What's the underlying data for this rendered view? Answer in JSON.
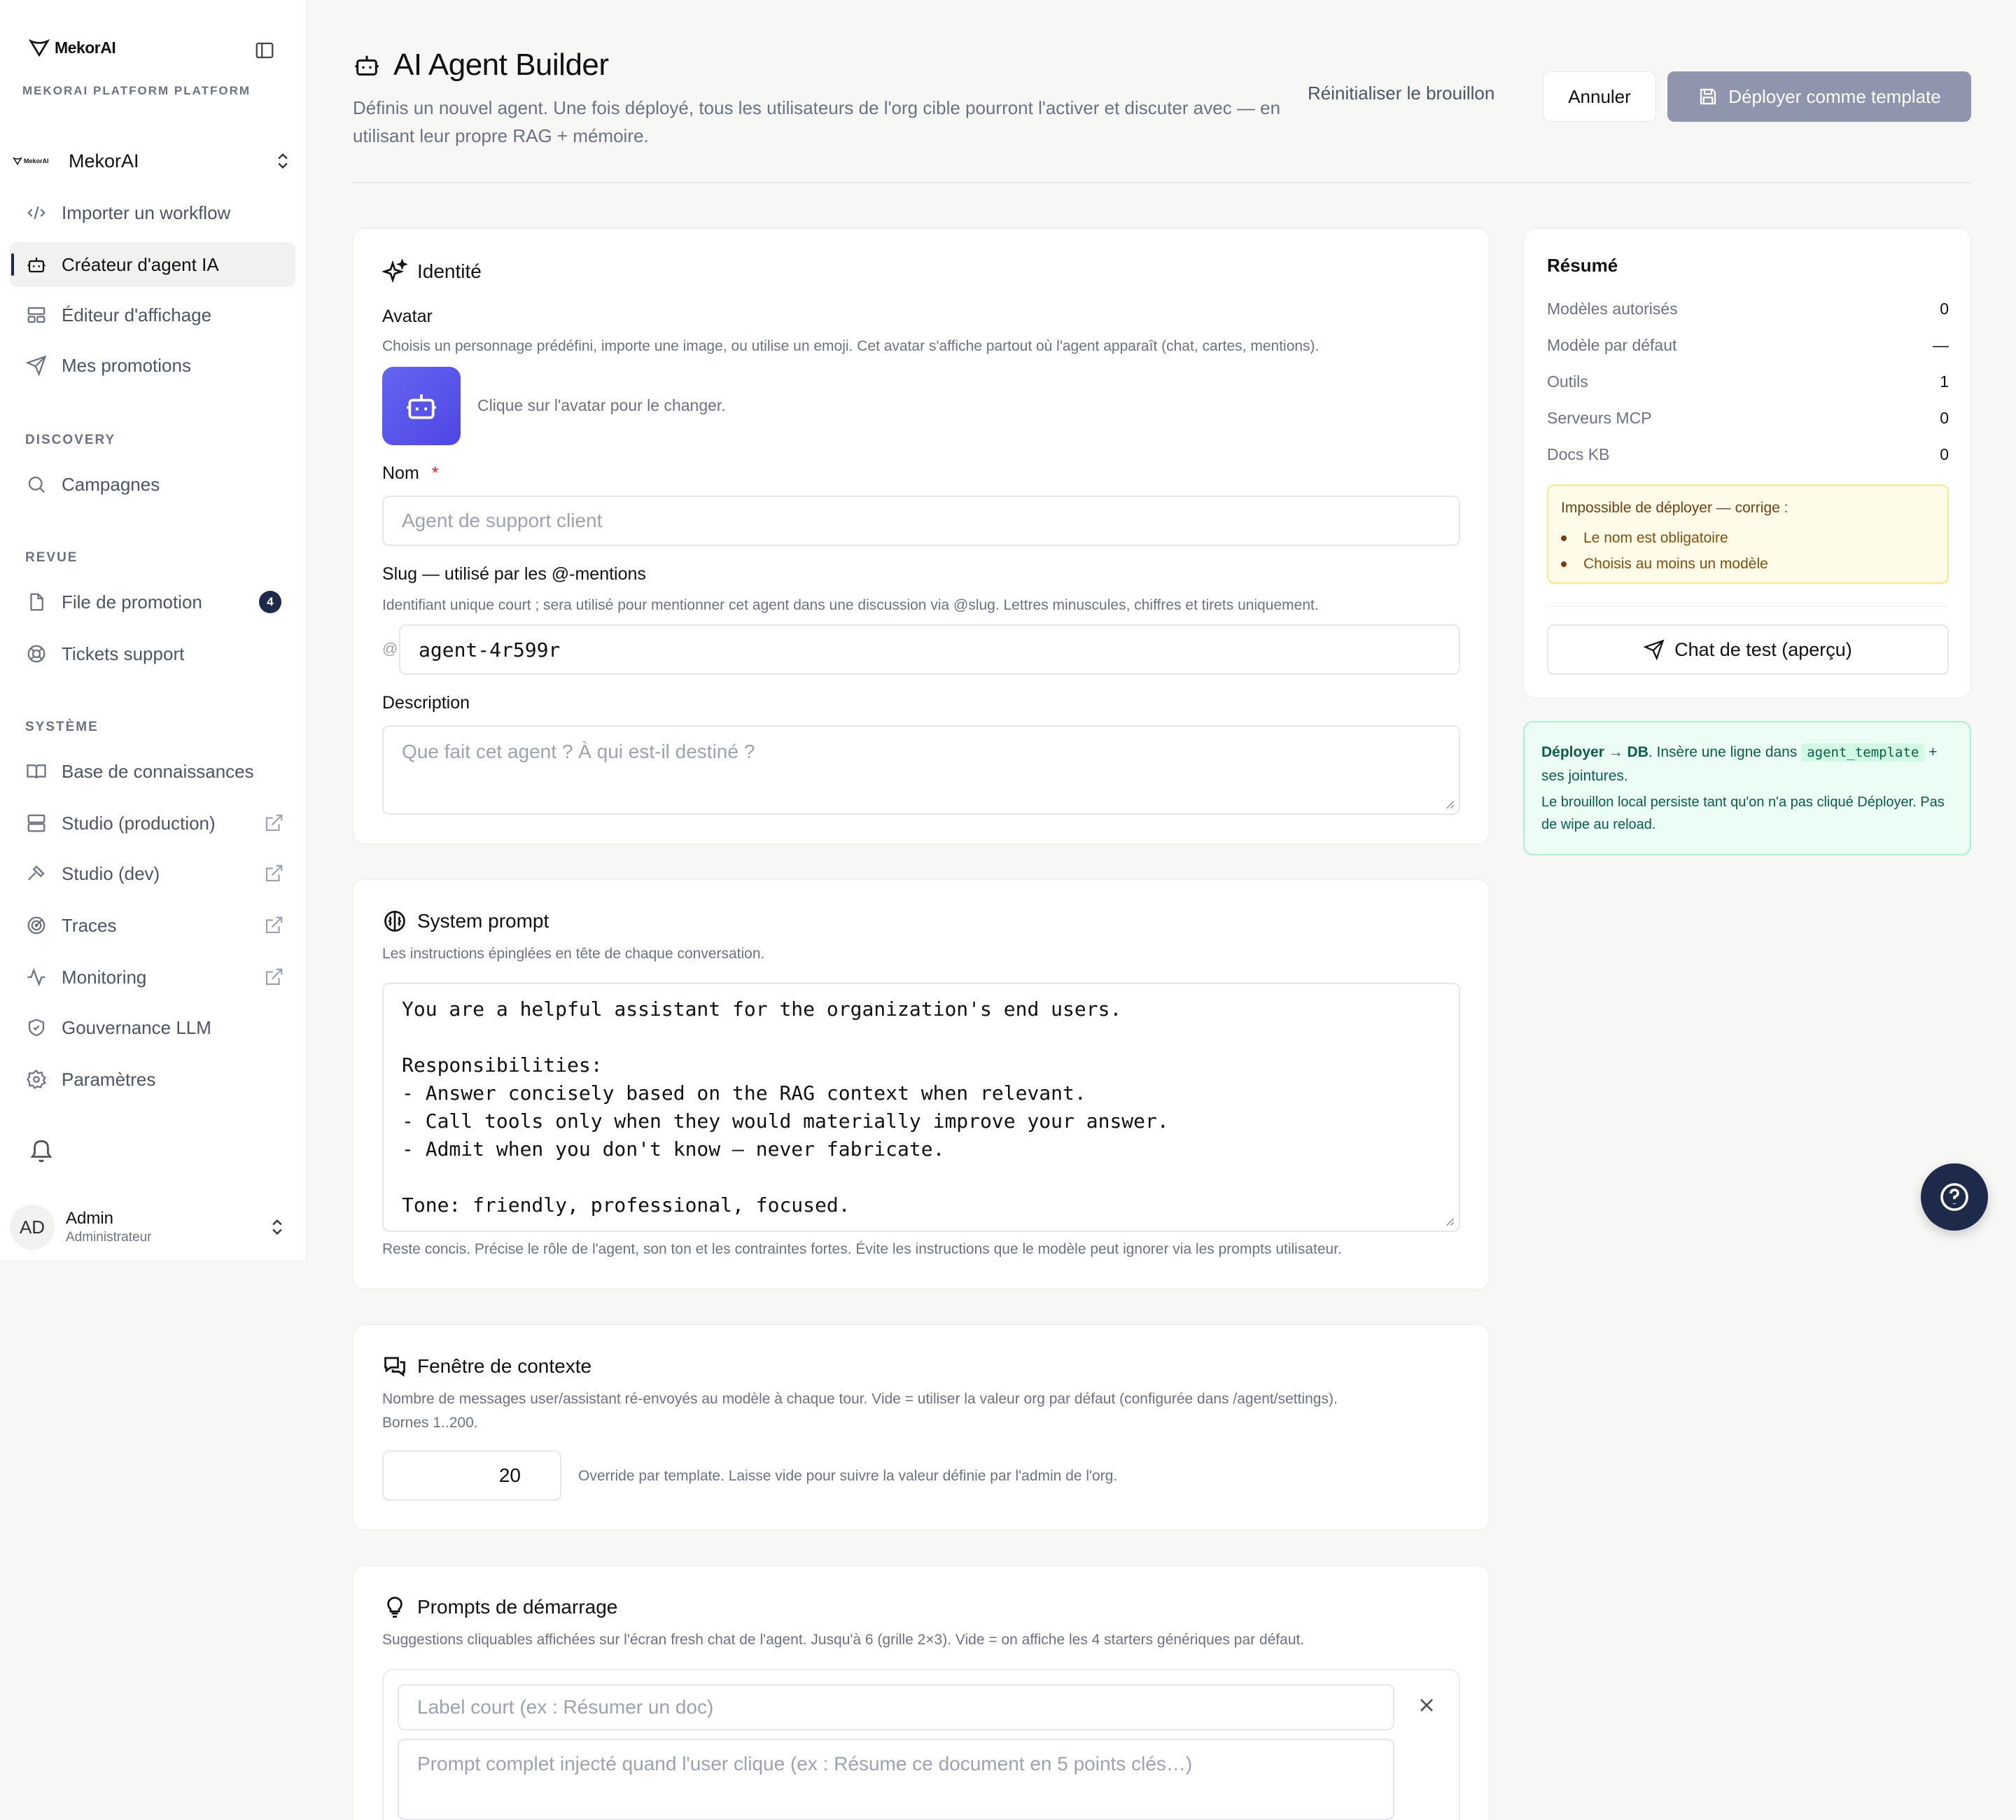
{
  "brand": {
    "name": "MekorAI",
    "platform_label": "MEKORAI PLATFORM PLATFORM"
  },
  "org": {
    "logo_text": "MekorAI",
    "name": "MekorAI"
  },
  "nav": {
    "top": [
      {
        "label": "Importer un workflow",
        "icon": "code-icon"
      },
      {
        "label": "Créateur d'agent IA",
        "icon": "bot-icon",
        "active": true
      },
      {
        "label": "Éditeur d'affichage",
        "icon": "layout-icon"
      },
      {
        "label": "Mes promotions",
        "icon": "send-icon"
      }
    ],
    "discovery_label": "DISCOVERY",
    "discovery": [
      {
        "label": "Campagnes",
        "icon": "search-icon"
      }
    ],
    "revue_label": "REVUE",
    "revue": [
      {
        "label": "File de promotion",
        "icon": "file-icon",
        "badge": "4"
      },
      {
        "label": "Tickets support",
        "icon": "lifebuoy-icon"
      }
    ],
    "systeme_label": "SYSTÈME",
    "systeme": [
      {
        "label": "Base de connaissances",
        "icon": "book-icon"
      },
      {
        "label": "Studio (production)",
        "icon": "server-icon",
        "external": true
      },
      {
        "label": "Studio (dev)",
        "icon": "hammer-icon",
        "external": true
      },
      {
        "label": "Traces",
        "icon": "radar-icon",
        "external": true
      },
      {
        "label": "Monitoring",
        "icon": "activity-icon",
        "external": true
      },
      {
        "label": "Gouvernance LLM",
        "icon": "shield-icon"
      },
      {
        "label": "Paramètres",
        "icon": "gear-icon"
      }
    ]
  },
  "user": {
    "initials": "AD",
    "name": "Admin",
    "role": "Administrateur"
  },
  "header": {
    "title": "AI Agent Builder",
    "subtitle": "Définis un nouvel agent. Une fois déployé, tous les utilisateurs de l'org cible pourront l'activer et discuter avec — en utilisant leur propre RAG + mémoire.",
    "reset_label": "Réinitialiser le brouillon",
    "cancel_label": "Annuler",
    "deploy_label": "Déployer comme template"
  },
  "identity": {
    "title": "Identité",
    "avatar_label": "Avatar",
    "avatar_help": "Choisis un personnage prédéfini, importe une image, ou utilise un emoji. Cet avatar s'affiche partout où l'agent apparaît (chat, cartes, mentions).",
    "avatar_hint": "Clique sur l'avatar pour le changer.",
    "name_label": "Nom",
    "name_required": "*",
    "name_placeholder": "Agent de support client",
    "slug_label": "Slug — utilisé par les @-mentions",
    "slug_help": "Identifiant unique court ; sera utilisé pour mentionner cet agent dans une discussion via @slug. Lettres minuscules, chiffres et tirets uniquement.",
    "slug_prefix": "@",
    "slug_value": "agent-4r599r",
    "desc_label": "Description",
    "desc_placeholder": "Que fait cet agent ? À qui est-il destiné ?"
  },
  "system_prompt": {
    "title": "System prompt",
    "help": "Les instructions épinglées en tête de chaque conversation.",
    "value": "You are a helpful assistant for the organization's end users.\n\nResponsibilities:\n- Answer concisely based on the RAG context when relevant.\n- Call tools only when they would materially improve your answer.\n- Admit when you don't know — never fabricate.\n\nTone: friendly, professional, focused.",
    "footer_help": "Reste concis. Précise le rôle de l'agent, son ton et les contraintes fortes. Évite les instructions que le modèle peut ignorer via les prompts utilisateur."
  },
  "context_window": {
    "title": "Fenêtre de contexte",
    "help_line1": "Nombre de messages user/assistant ré-envoyés au modèle à chaque tour. Vide = utiliser la valeur org par défaut (configurée dans /agent/settings).",
    "help_line2": "Bornes 1..200.",
    "value": "20",
    "override_help": "Override par template. Laisse vide pour suivre la valeur définie par l'admin de l'org."
  },
  "starters": {
    "title": "Prompts de démarrage",
    "help": "Suggestions cliquables affichées sur l'écran fresh chat de l'agent. Jusqu'à 6 (grille 2×3). Vide = on affiche les 4 starters génériques par défaut.",
    "label_placeholder": "Label court (ex : Résumer un doc)",
    "prompt_placeholder": "Prompt complet injecté quand l'user clique (ex : Résume ce document en 5 points clés…)"
  },
  "summary": {
    "title": "Résumé",
    "rows": [
      {
        "key": "Modèles autorisés",
        "value": "0"
      },
      {
        "key": "Modèle par défaut",
        "value": "—"
      },
      {
        "key": "Outils",
        "value": "1"
      },
      {
        "key": "Serveurs MCP",
        "value": "0"
      },
      {
        "key": "Docs KB",
        "value": "0"
      }
    ],
    "warning_title": "Impossible de déployer — corrige :",
    "warnings": [
      "Le nom est obligatoire",
      "Choisis au moins un modèle"
    ],
    "test_chat_label": "Chat de test (aperçu)"
  },
  "deploy_info": {
    "bold": "Déployer → DB",
    "text_before_code": ". Insère une ligne dans",
    "code": "agent_template",
    "text_after_code": "+ ses jointures.",
    "line2": "Le brouillon local persiste tant qu'on n'a pas cliqué Déployer. Pas de wipe au reload."
  },
  "colors": {
    "accent": "#1e2a4a",
    "deploy_button": "#8e95ad",
    "avatar_gradient": "#5b5ef0",
    "warning_bg": "#fefce8",
    "info_bg": "#ecfdf5"
  }
}
